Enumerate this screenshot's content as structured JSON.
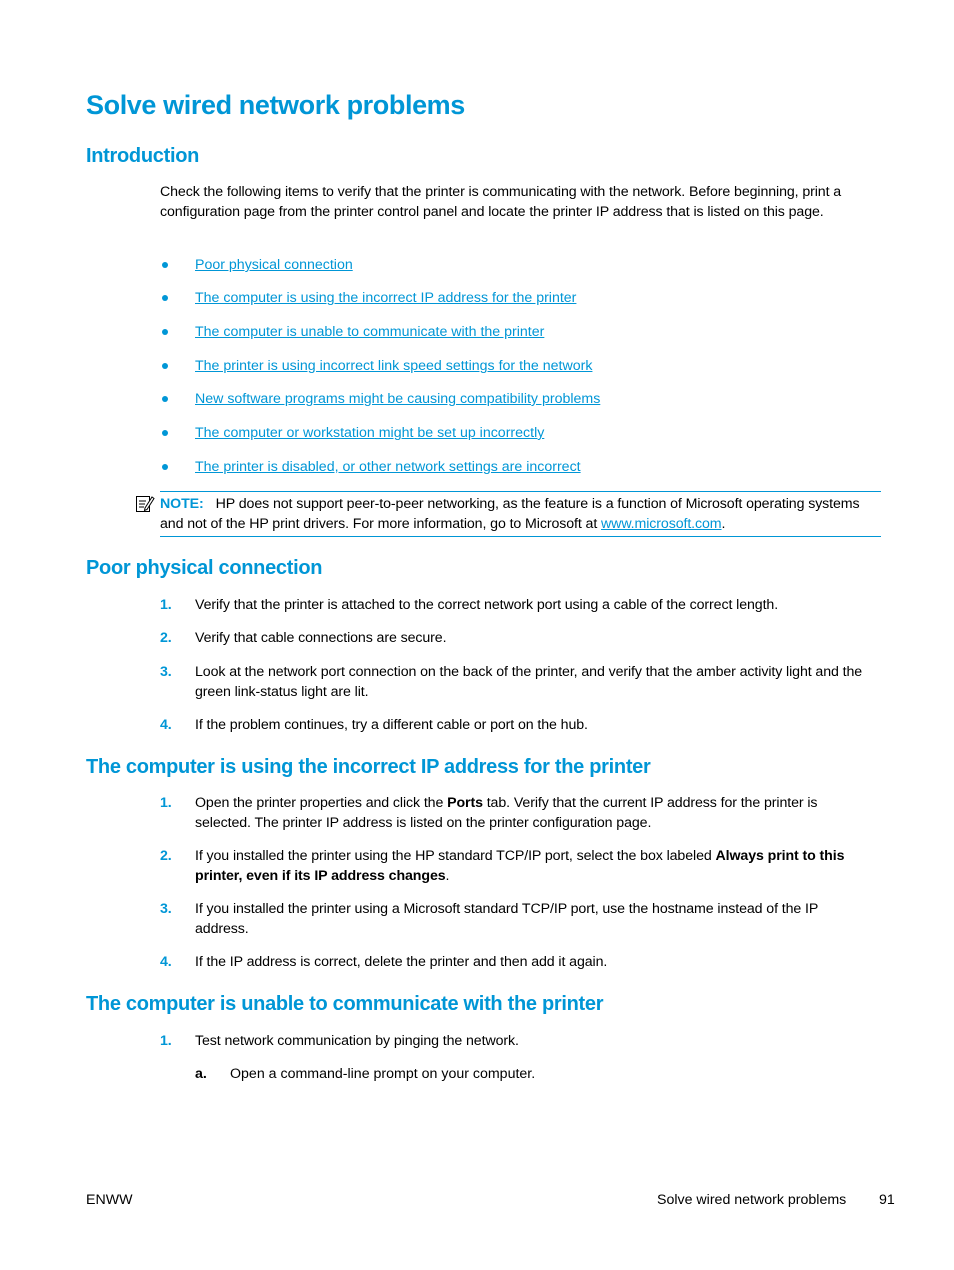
{
  "page": {
    "title": "Solve wired network problems",
    "footer": {
      "left": "ENWW",
      "section": "Solve wired network problems",
      "page_number": "91"
    }
  },
  "introduction": {
    "heading": "Introduction",
    "paragraph": "Check the following items to verify that the printer is communicating with the network. Before beginning, print a configuration page from the printer control panel and locate the printer IP address that is listed on this page.",
    "links": [
      "Poor physical connection",
      "The computer is using the incorrect IP address for the printer",
      "The computer is unable to communicate with the printer",
      "The printer is using incorrect link speed settings for the network",
      "New software programs might be causing compatibility problems",
      "The computer or workstation might be set up incorrectly",
      "The printer is disabled, or other network settings are incorrect"
    ],
    "note": {
      "icon": "note-pencil-icon",
      "label": "NOTE:",
      "text_before": "HP does not support peer-to-peer networking, as the feature is a function of Microsoft operating systems and not of the HP print drivers. For more information, go to Microsoft at ",
      "link": "www.microsoft.com",
      "text_after": "."
    }
  },
  "poor_physical_connection": {
    "heading": "Poor physical connection",
    "steps": [
      {
        "num": "1.",
        "text": "Verify that the printer is attached to the correct network port using a cable of the correct length."
      },
      {
        "num": "2.",
        "text": "Verify that cable connections are secure."
      },
      {
        "num": "3.",
        "text": "Look at the network port connection on the back of the printer, and verify that the amber activity light and the green link-status light are lit."
      },
      {
        "num": "4.",
        "text": "If the problem continues, try a different cable or port on the hub."
      }
    ]
  },
  "incorrect_ip": {
    "heading": "The computer is using the incorrect IP address for the printer",
    "steps": [
      {
        "num": "1.",
        "pre": "Open the printer properties and click the ",
        "bold": "Ports",
        "post": " tab. Verify that the current IP address for the printer is selected. The printer IP address is listed on the printer configuration page."
      },
      {
        "num": "2.",
        "pre": "If you installed the printer using the HP standard TCP/IP port, select the box labeled ",
        "bold": "Always print to this printer, even if its IP address changes",
        "post": "."
      },
      {
        "num": "3.",
        "text": "If you installed the printer using a Microsoft standard TCP/IP port, use the hostname instead of the IP address."
      },
      {
        "num": "4.",
        "text": "If the IP address is correct, delete the printer and then add it again."
      }
    ]
  },
  "unable_to_communicate": {
    "heading": "The computer is unable to communicate with the printer",
    "steps": [
      {
        "num": "1.",
        "text": "Test network communication by pinging the network."
      }
    ],
    "substeps": [
      {
        "num": "a.",
        "text": "Open a command-line prompt on your computer."
      }
    ]
  }
}
